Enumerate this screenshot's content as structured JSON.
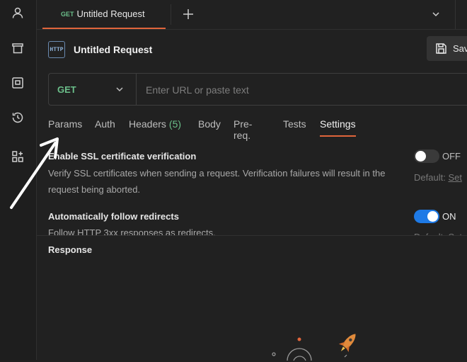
{
  "tab": {
    "method": "GET",
    "title": "Untitled Request"
  },
  "request": {
    "icon_text": "HTTP",
    "title": "Untitled Request",
    "save_label": "Save",
    "method": "GET",
    "url_placeholder": "Enter URL or paste text"
  },
  "subtabs": [
    {
      "label": "Params",
      "count": null,
      "active": false
    },
    {
      "label": "Auth",
      "count": null,
      "active": false
    },
    {
      "label": "Headers",
      "count": "(5)",
      "active": false
    },
    {
      "label": "Body",
      "count": null,
      "active": false
    },
    {
      "label": "Pre-req.",
      "count": null,
      "active": false
    },
    {
      "label": "Tests",
      "count": null,
      "active": false
    },
    {
      "label": "Settings",
      "count": null,
      "active": true
    }
  ],
  "settings": [
    {
      "title": "Enable SSL certificate verification",
      "description": "Verify SSL certificates when sending a request. Verification failures will result in the request being aborted.",
      "toggle_label": "OFF",
      "enabled": false,
      "default_prefix": "Default:",
      "default_link": "Set"
    },
    {
      "title": "Automatically follow redirects",
      "description": "Follow HTTP 3xx responses as redirects.",
      "toggle_label": "ON",
      "enabled": true,
      "default_prefix": "Default:",
      "default_link": "Set"
    }
  ],
  "response": {
    "title": "Response"
  },
  "colors": {
    "accent": "#e0653b",
    "method_green": "#6bbf8a",
    "toggle_on": "#1e7ae6",
    "background": "#212121"
  },
  "icons": {
    "sidebar": [
      "user-icon",
      "trash-icon",
      "collection-icon",
      "history-icon",
      "apps-icon"
    ],
    "other": [
      "plus-icon",
      "chevron-down-icon",
      "save-icon",
      "http-icon",
      "rocket-icon",
      "astronaut-icon"
    ]
  }
}
